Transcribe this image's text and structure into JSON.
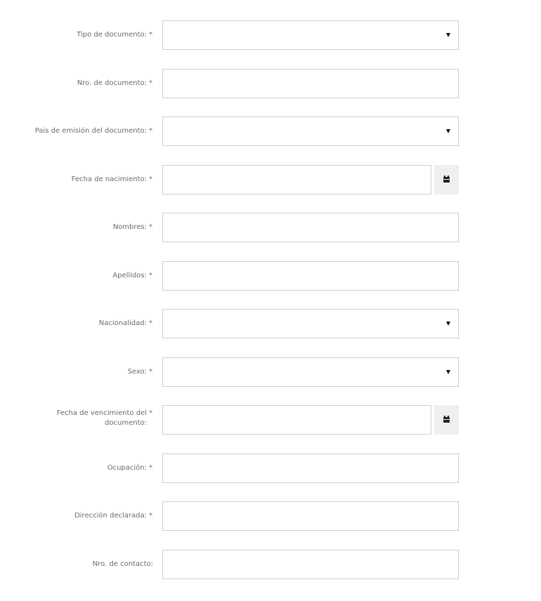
{
  "colors": {
    "label_text": "#6b6b6b",
    "required_marker": "#b5495b",
    "input_border": "#cfcfcf",
    "button_bg": "#efefef"
  },
  "required_marker": "*",
  "fields": [
    {
      "id": "tipo-documento",
      "label": "Tipo de documento:",
      "required": true,
      "type": "select",
      "value": ""
    },
    {
      "id": "nro-documento",
      "label": "Nro. de documento:",
      "required": true,
      "type": "text",
      "value": ""
    },
    {
      "id": "pais-emision",
      "label": "Pais de emisión del documento:",
      "required": true,
      "type": "select",
      "value": ""
    },
    {
      "id": "fecha-nacimiento",
      "label": "Fecha de nacimiento:",
      "required": true,
      "type": "date",
      "value": "",
      "button_icon": "calendar-icon"
    },
    {
      "id": "nombres",
      "label": "Nombres:",
      "required": true,
      "type": "text",
      "value": ""
    },
    {
      "id": "apellidos",
      "label": "Apellidos:",
      "required": true,
      "type": "text",
      "value": ""
    },
    {
      "id": "nacionalidad",
      "label": "Nacionalidad:",
      "required": true,
      "type": "select",
      "value": ""
    },
    {
      "id": "sexo",
      "label": "Sexo:",
      "required": true,
      "type": "select",
      "value": ""
    },
    {
      "id": "fecha-vencimiento",
      "label": "Fecha de vencimiento del documento:",
      "required": true,
      "type": "date",
      "value": "",
      "button_icon": "calendar-icon"
    },
    {
      "id": "ocupacion",
      "label": "Ocupación:",
      "required": true,
      "type": "text",
      "value": ""
    },
    {
      "id": "direccion-declarada",
      "label": "Dirección declarada:",
      "required": true,
      "type": "text",
      "value": ""
    },
    {
      "id": "nro-contacto",
      "label": "Nro. de contacto:",
      "required": false,
      "type": "text",
      "value": ""
    }
  ]
}
